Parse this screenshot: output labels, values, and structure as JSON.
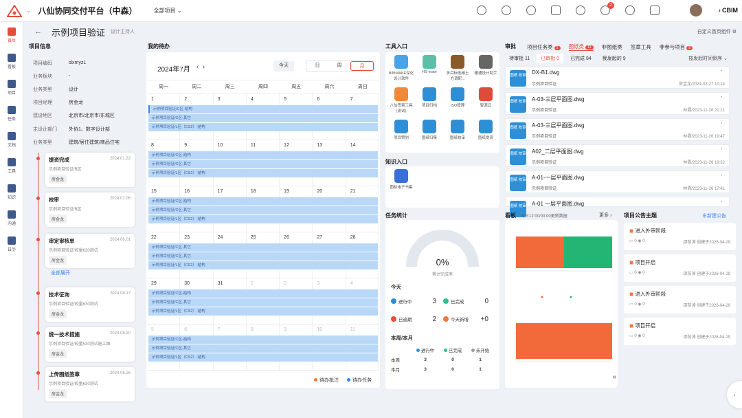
{
  "app": {
    "title": "八仙协同交付平台（中森）",
    "project_select": "全部项目"
  },
  "brand": {
    "logo_text": "CBIM"
  },
  "notifications_count": "2",
  "sidebar": [
    {
      "label": "首页",
      "icon": "home-icon",
      "active": true
    },
    {
      "label": "看板",
      "icon": "dashboard-icon"
    },
    {
      "label": "项目",
      "icon": "project-icon"
    },
    {
      "label": "任务",
      "icon": "task-icon"
    },
    {
      "label": "文档",
      "icon": "document-icon"
    },
    {
      "label": "工具",
      "icon": "tool-icon"
    },
    {
      "label": "知识",
      "icon": "knowledge-icon"
    },
    {
      "label": "沟通",
      "icon": "chat-icon"
    },
    {
      "label": "日历",
      "icon": "calendar-icon"
    }
  ],
  "header": {
    "title": "示例项目验证",
    "subtitle": "设计主持人",
    "custom_label": "自定义首页组件"
  },
  "project_info": {
    "title": "项目信息",
    "rows": [
      {
        "k": "项目编码",
        "v": "slxmyz1"
      },
      {
        "k": "业务板块",
        "v": "-"
      },
      {
        "k": "业务类型",
        "v": "设计"
      },
      {
        "k": "项目经理",
        "v": "房金龙"
      },
      {
        "k": "建设地区",
        "v": "北京市/北京市/东城区"
      },
      {
        "k": "主设计部门",
        "v": "外协1、数字设计部"
      },
      {
        "k": "业务类型",
        "v": "建筑/居住建筑/商品住宅"
      }
    ],
    "timeline": [
      {
        "t": "提资完成",
        "d": "2024.01.22",
        "s": "示例项目验证/B区",
        "p": "房金龙"
      },
      {
        "t": "校审",
        "d": "2024.02.06",
        "s": "示例项目验证/B区",
        "p": "房金龙"
      },
      {
        "t": "审定审核单",
        "d": "2024.06.01",
        "s": "示例项目验证/校量630测试",
        "p": "房金龙"
      },
      {
        "t": "技术征询",
        "d": "2024.08.17",
        "s": "示例项目验证/校量630测试",
        "p": "房金龙"
      },
      {
        "t": "统一技术措施",
        "d": "2024.08.20",
        "s": "示例项目验证/校量530测试施工图",
        "p": "房金龙"
      },
      {
        "t": "上传图纸签章",
        "d": "2024.06.26",
        "s": "示例项目验证/校量630测试",
        "p": "房金龙"
      }
    ],
    "expand_label": "全部展开"
  },
  "todo": {
    "title": "我的待办",
    "month": "2024年7月",
    "today": "今天",
    "views": [
      "日",
      "周",
      "月"
    ],
    "active_view": "月",
    "weekdays": [
      "周一",
      "周二",
      "周三",
      "周四",
      "周五",
      "周六",
      "周日"
    ],
    "weeks": [
      {
        "days": [
          "1",
          "2",
          "3",
          "4",
          "5",
          "6",
          "7"
        ],
        "events": [
          "示例项目验证/C区-结构",
          "示例项目验证/C区-其它",
          "示例项目验证/L区（CS2）-结构"
        ]
      },
      {
        "days": [
          "8",
          "9",
          "10",
          "11",
          "12",
          "13",
          "14"
        ],
        "events": [
          "示例项目验证/C区-结构",
          "示例项目验证/C区-其它",
          "示例项目验证/L区（CS2）-结构"
        ]
      },
      {
        "days": [
          "15",
          "16",
          "17",
          "18",
          "19",
          "20",
          "21"
        ],
        "events": [
          "示例项目验证/C区-结构",
          "示例项目验证/C区-其它",
          "示例项目验证/L区（CS2）-结构"
        ]
      },
      {
        "days": [
          "22",
          "23",
          "24",
          "25",
          "26",
          "27",
          "28"
        ],
        "events": [
          "示例项目验证/C区-其它",
          "示例项目验证/C区-其它",
          "示例项目验证/L区（CS2）-结构"
        ]
      },
      {
        "days": [
          "29",
          "30",
          "31",
          "1",
          "2",
          "3",
          "4"
        ],
        "events": [
          "示例项目验证/C区-结构",
          "示例项目验证/C区-其它",
          "示例项目验证/L区（CS2）-结构"
        ]
      },
      {
        "days": [
          "5",
          "6",
          "7",
          "8",
          "9",
          "10",
          "11"
        ],
        "events": [
          "示例项目验证/C区-结构",
          "示例项目验证/C区-其它",
          "示例项目验证/L区（CS2）-结构"
        ]
      }
    ],
    "legend": [
      {
        "label": "待办批注",
        "color": "#f07a3a"
      },
      {
        "label": "待办任务",
        "color": "#3b82f6"
      }
    ]
  },
  "tools": {
    "title": "工具入口",
    "items": [
      {
        "label": "BIMMAKE深化设计软件",
        "color": "#4aa3e8",
        "icon": "bimmake-icon"
      },
      {
        "label": "HS-mate",
        "color": "#5cc0a8",
        "icon": "hsmate-icon"
      },
      {
        "label": "多目标低碳土方调配...",
        "color": "#8b5a2b",
        "icon": "owl-icon"
      },
      {
        "label": "暖通设计助手",
        "color": "#666666",
        "icon": "hvac-icon"
      },
      {
        "label": "八仙签章工具(测试)",
        "color": "#f08a3a",
        "icon": "stamp-icon"
      },
      {
        "label": "项目归档",
        "color": "#2f8fd6",
        "icon": "archive-icon"
      },
      {
        "label": "ISO管理",
        "color": "#2f8fd6",
        "icon": "iso-icon"
      },
      {
        "label": "智源云",
        "color": "#e04a3a",
        "icon": "cloud-icon"
      },
      {
        "label": "项目策划",
        "color": "#2f8fd6",
        "icon": "plan-icon"
      },
      {
        "label": "图纸归集",
        "color": "#2f8fd6",
        "icon": "drawing-collect-icon"
      },
      {
        "label": "图纸校审",
        "color": "#2f8fd6",
        "icon": "drawing-review-icon"
      },
      {
        "label": "图纸提资",
        "color": "#2f8fd6",
        "icon": "drawing-submit-icon"
      }
    ]
  },
  "knowledge": {
    "title": "知识入口",
    "items": [
      {
        "label": "图标电子书集",
        "color": "#3b6fd8",
        "icon": "ebook-icon"
      }
    ]
  },
  "task_stats": {
    "title": "任务统计",
    "percent": "0%",
    "percent_label": "累计完成率",
    "today_label": "今天",
    "today": [
      {
        "label": "进行中",
        "value": "3",
        "color": "#2f8fd6"
      },
      {
        "label": "已完成",
        "value": "0",
        "color": "#2bc48a"
      },
      {
        "label": "已逾期",
        "value": "2",
        "color": "#e74c3c"
      },
      {
        "label": "今天新增",
        "value": "+0",
        "color": "#f07a3a"
      }
    ],
    "wm_label": "本周/本月",
    "wm_headers": [
      "进行中",
      "已完成",
      "未开始"
    ],
    "wm_header_colors": [
      "#2f8fd6",
      "#2bc48a",
      "#999999"
    ],
    "wm_rows": [
      {
        "k": "本周",
        "v": [
          "3",
          "0",
          "1"
        ]
      },
      {
        "k": "本月",
        "v": [
          "3",
          "0",
          "1"
        ]
      }
    ]
  },
  "review": {
    "title": "审批",
    "tabs": [
      {
        "label": "项目任务类",
        "badge": "1"
      },
      {
        "label": "图纸类",
        "badge": "11",
        "active": true
      },
      {
        "label": "非图纸类",
        "badge": ""
      },
      {
        "label": "签章工具",
        "badge": ""
      },
      {
        "label": "非参与项目",
        "badge": "5"
      }
    ],
    "subtabs": [
      "待审批 11",
      "已审批 0",
      "已完成 84",
      "我发起的 9"
    ],
    "active_subtab": "已审批 0",
    "order": "按发起时间倒序",
    "icon_label": "图纸 校审",
    "items": [
      {
        "name": "DX-B1.dwg",
        "proj": "示例项目验证",
        "meta": "房金龙/2024-02-27 10:24"
      },
      {
        "name": "A-03-三层平面图.dwg",
        "proj": "示例项目验证",
        "meta": "林霞/2023-11-26 21:21"
      },
      {
        "name": "A-03-三层平面图.dwg",
        "proj": "示例项目验证",
        "meta": "林霞/2023-11-26 19:47"
      },
      {
        "name": "A02_二层平面图.dwg",
        "proj": "示例项目验证",
        "meta": "林霞/2023-11-26 19:32"
      },
      {
        "name": "A-01-一层平面图.dwg",
        "proj": "示例项目验证",
        "meta": "林霞/2023-11-26 17:41"
      },
      {
        "name": "A-01 一层平面图.dwg",
        "proj": "",
        "meta": ""
      }
    ]
  },
  "board": {
    "title": "看板",
    "update": "每日12:00/00:00更新数据",
    "more": "更多"
  },
  "notice": {
    "title": "项目公告主题",
    "new": "新建公告",
    "items": [
      {
        "t": "进入外审阶段",
        "m": "邵前涛 创建于2026-04-29",
        "c": "0",
        "v": "0"
      },
      {
        "t": "项目开启",
        "m": "邵前涛 创建于2026-04-29",
        "c": "0",
        "v": "0"
      },
      {
        "t": "进入外审阶段",
        "m": "邵前涛 创建于2026-04-29",
        "c": "0",
        "v": "0"
      },
      {
        "t": "项目开启",
        "m": "邵前涛 创建于2026-04-29",
        "c": "0",
        "v": "0"
      }
    ]
  }
}
